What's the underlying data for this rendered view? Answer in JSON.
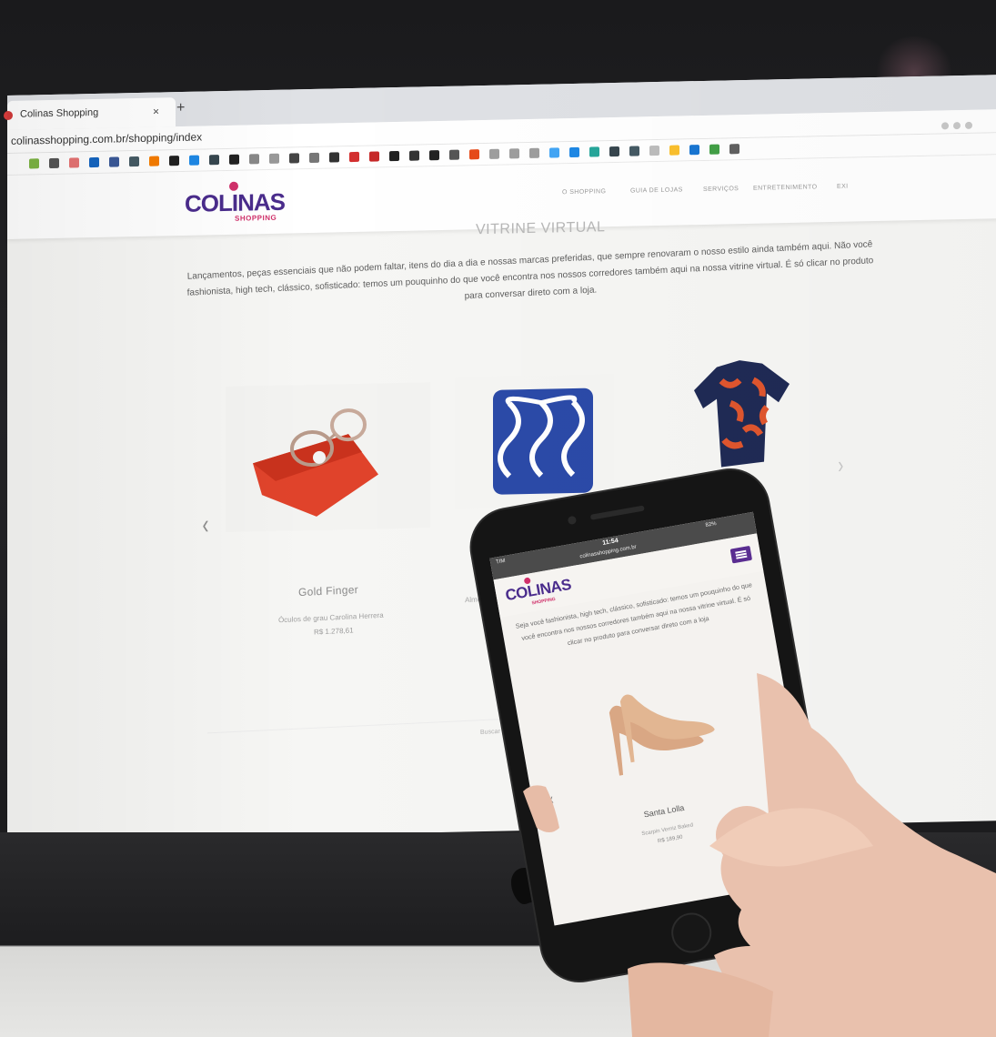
{
  "browser": {
    "tab_title": "Colinas Shopping",
    "tab_close": "×",
    "new_tab": "+",
    "url": "colinasshopping.com.br/shopping/index"
  },
  "site": {
    "logo_word": "COLINAS",
    "logo_sub": "SHOPPING",
    "nav": [
      "O SHOPPING",
      "GUIA DE LOJAS",
      "SERVIÇOS",
      "ENTRETENIMENTO",
      "EXI"
    ],
    "section_title": "VITRINE VIRTUAL",
    "intro": "Lançamentos, peças essenciais que não podem faltar, itens do dia a dia e nossas marcas preferidas, que sempre renovaram o nosso estilo ainda também aqui. Não você fashionista, high tech, clássico, sofisticado: temos um pouquinho do que você encontra nos nossos corredores também aqui na nossa vitrine virtual. É só clicar no produto para conversar direto com a loja.",
    "product": {
      "name": "Gold Finger",
      "description": "Óculos de grau Carolina Herrera",
      "price": "R$ 1.278,61"
    },
    "product2_desc": "Almofada deco",
    "search_hint": "Buscar por categoria"
  },
  "phone": {
    "carrier": "TIM",
    "time": "11:54",
    "battery": "82%",
    "url": "colinasshopping.com.br",
    "logo_word": "COLINAS",
    "logo_sub": "SHOPPING",
    "intro": "Seja você fashionista, high tech, clássico, sofisticado: temos um pouquinho do que você encontra nos nossos corredores também aqui na nossa vitrine virtual. É só clicar no produto para conversar direto com a loja",
    "product": {
      "name": "Santa Lolla",
      "description": "Scarpin Verniz Baked",
      "price": "R$ 189,90"
    }
  },
  "colors": {
    "brand_purple": "#4a2c8c",
    "brand_pink": "#d0306a",
    "menu_purple": "#5a2d91"
  }
}
